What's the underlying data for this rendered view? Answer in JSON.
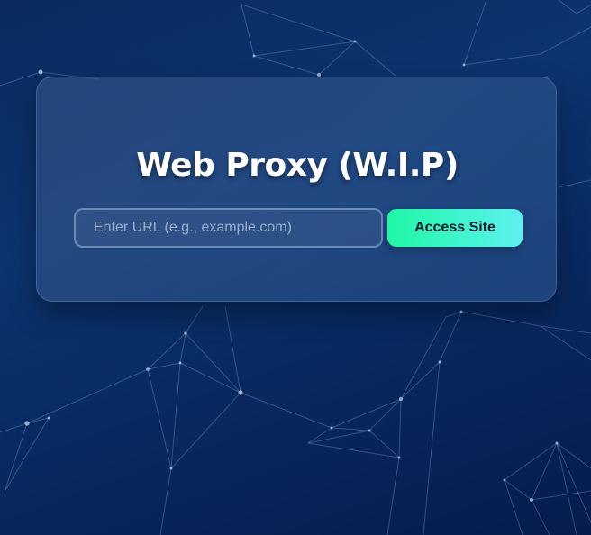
{
  "page": {
    "title": "Web Proxy (W.I.P)"
  },
  "form": {
    "url_input": {
      "value": "",
      "placeholder": "Enter URL (e.g., example.com)"
    },
    "access_button_label": "Access Site"
  },
  "colors": {
    "background": "#0a2a5e",
    "card": "#3a5a8c",
    "button_start": "#1ff7a4",
    "button_end": "#5ef0f0",
    "title_text": "#ffffff"
  }
}
